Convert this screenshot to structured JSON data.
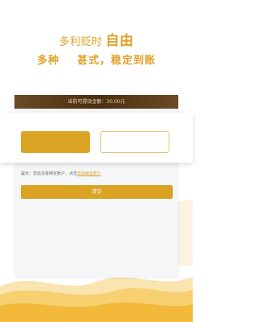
{
  "headline": {
    "line1_part1": "多利",
    "line1_part2": "贬",
    "line1_part3": "时",
    "line1_strong": "自由",
    "line2_left": "多种",
    "line2_right": "甚式，稳定到账"
  },
  "balance": {
    "label": "当前可提现金额：",
    "amount": "30.00元"
  },
  "tip": {
    "text": "提示：您还没有绑定账户，点击",
    "link": "添加绑定账户"
  },
  "submit": {
    "label": "提交"
  },
  "colors": {
    "accent": "#dba324",
    "headline": "#e0a12a",
    "balance_bar": "#4a2f13",
    "background": "#ffffff",
    "card": "#f4f6f8",
    "wave": "#f5c24a"
  }
}
